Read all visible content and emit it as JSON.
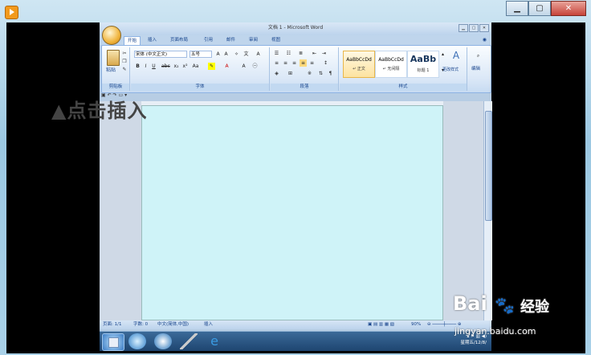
{
  "word": {
    "title": "文档 1 - Microsoft Word",
    "tabs": [
      {
        "label": "开始"
      },
      {
        "label": "插入"
      },
      {
        "label": "页面布局"
      },
      {
        "label": "引用"
      },
      {
        "label": "邮件"
      },
      {
        "label": "审阅"
      },
      {
        "label": "视图"
      }
    ],
    "ribbon": {
      "clipboard": {
        "label": "剪贴板",
        "paste": "粘贴"
      },
      "font": {
        "label": "字体",
        "font_name": "宋体 (中文正文)",
        "font_size": "五号"
      },
      "paragraph": {
        "label": "段落"
      },
      "styles": {
        "label": "样式",
        "items": [
          {
            "sample": "AaBbCcDd",
            "name": "↵ 正文"
          },
          {
            "sample": "AaBbCcDd",
            "name": "↵ 无间隔"
          },
          {
            "sample": "AaBb",
            "name": "标题 1"
          }
        ],
        "change_styles": "更改样式"
      },
      "editing": {
        "label": "编辑"
      }
    },
    "document": {
      "heading": "▲点击插入"
    },
    "status": {
      "page": "页面: 1/1",
      "words": "字数: 0",
      "lang": "中文(简体,中国)",
      "mode": "插入",
      "zoom": "90%"
    }
  },
  "taskbar": {
    "time": "星期五/12/8/"
  },
  "watermark": {
    "brand": "Bai",
    "brand_suffix": "经验",
    "url": "jingyan.baidu.com"
  }
}
